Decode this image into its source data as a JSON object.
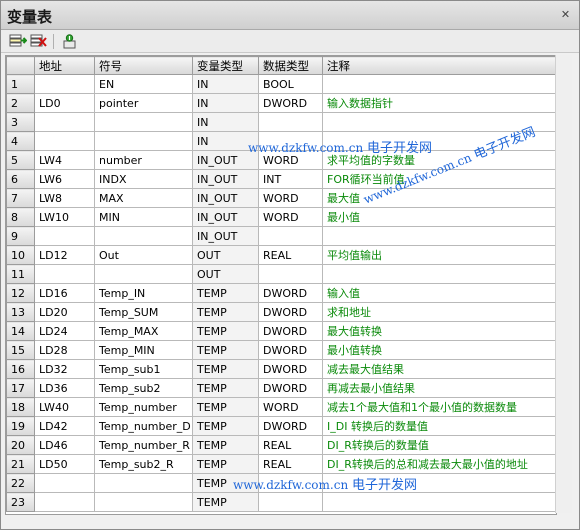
{
  "window": {
    "title": "变量表"
  },
  "toolbar": {
    "buttons": [
      {
        "name": "insert-row",
        "icon": "insert-row-icon"
      },
      {
        "name": "delete-row",
        "icon": "delete-row-icon"
      },
      {
        "name": "import",
        "icon": "import-icon"
      }
    ]
  },
  "table": {
    "headers": [
      "",
      "地址",
      "符号",
      "变量类型",
      "数据类型",
      "注释"
    ],
    "rows": [
      [
        "1",
        "",
        "EN",
        "IN",
        "BOOL",
        ""
      ],
      [
        "2",
        "LD0",
        "pointer",
        "IN",
        "DWORD",
        "输入数据指针"
      ],
      [
        "3",
        "",
        "",
        "IN",
        "",
        ""
      ],
      [
        "4",
        "",
        "",
        "IN",
        "",
        ""
      ],
      [
        "5",
        "LW4",
        "number",
        "IN_OUT",
        "WORD",
        "求平均值的字数量"
      ],
      [
        "6",
        "LW6",
        "INDX",
        "IN_OUT",
        "INT",
        "FOR循环当前值"
      ],
      [
        "7",
        "LW8",
        "MAX",
        "IN_OUT",
        "WORD",
        "最大值"
      ],
      [
        "8",
        "LW10",
        "MIN",
        "IN_OUT",
        "WORD",
        "最小值"
      ],
      [
        "9",
        "",
        "",
        "IN_OUT",
        "",
        ""
      ],
      [
        "10",
        "LD12",
        "Out",
        "OUT",
        "REAL",
        "平均值输出"
      ],
      [
        "11",
        "",
        "",
        "OUT",
        "",
        ""
      ],
      [
        "12",
        "LD16",
        "Temp_IN",
        "TEMP",
        "DWORD",
        "输入值"
      ],
      [
        "13",
        "LD20",
        "Temp_SUM",
        "TEMP",
        "DWORD",
        "求和地址"
      ],
      [
        "14",
        "LD24",
        "Temp_MAX",
        "TEMP",
        "DWORD",
        "最大值转换"
      ],
      [
        "15",
        "LD28",
        "Temp_MIN",
        "TEMP",
        "DWORD",
        "最小值转换"
      ],
      [
        "16",
        "LD32",
        "Temp_sub1",
        "TEMP",
        "DWORD",
        "减去最大值结果"
      ],
      [
        "17",
        "LD36",
        "Temp_sub2",
        "TEMP",
        "DWORD",
        "再减去最小值结果"
      ],
      [
        "18",
        "LW40",
        "Temp_number",
        "TEMP",
        "WORD",
        "减去1个最大值和1个最小值的数据数量"
      ],
      [
        "19",
        "LD42",
        "Temp_number_D",
        "TEMP",
        "DWORD",
        "I_DI 转换后的数量值"
      ],
      [
        "20",
        "LD46",
        "Temp_number_R",
        "TEMP",
        "REAL",
        "DI_R转换后的数量值"
      ],
      [
        "21",
        "LD50",
        "Temp_sub2_R",
        "TEMP",
        "REAL",
        "DI_R转换后的总和减去最大最小值的地址"
      ],
      [
        "22",
        "",
        "",
        "TEMP",
        "",
        ""
      ],
      [
        "23",
        "",
        "",
        "TEMP",
        "",
        ""
      ]
    ]
  },
  "watermarks": [
    {
      "url": "www.dzkfw.com.cn",
      "cn": "电子开发网"
    },
    {
      "url": "www.dzkfw.com.cn",
      "cn": "电子开发网"
    },
    {
      "url": "www.dzkfw.com.cn",
      "cn": "电子开发网"
    }
  ],
  "colors": {
    "comment": "#0a8a0a",
    "watermark": "#1f66d8"
  }
}
